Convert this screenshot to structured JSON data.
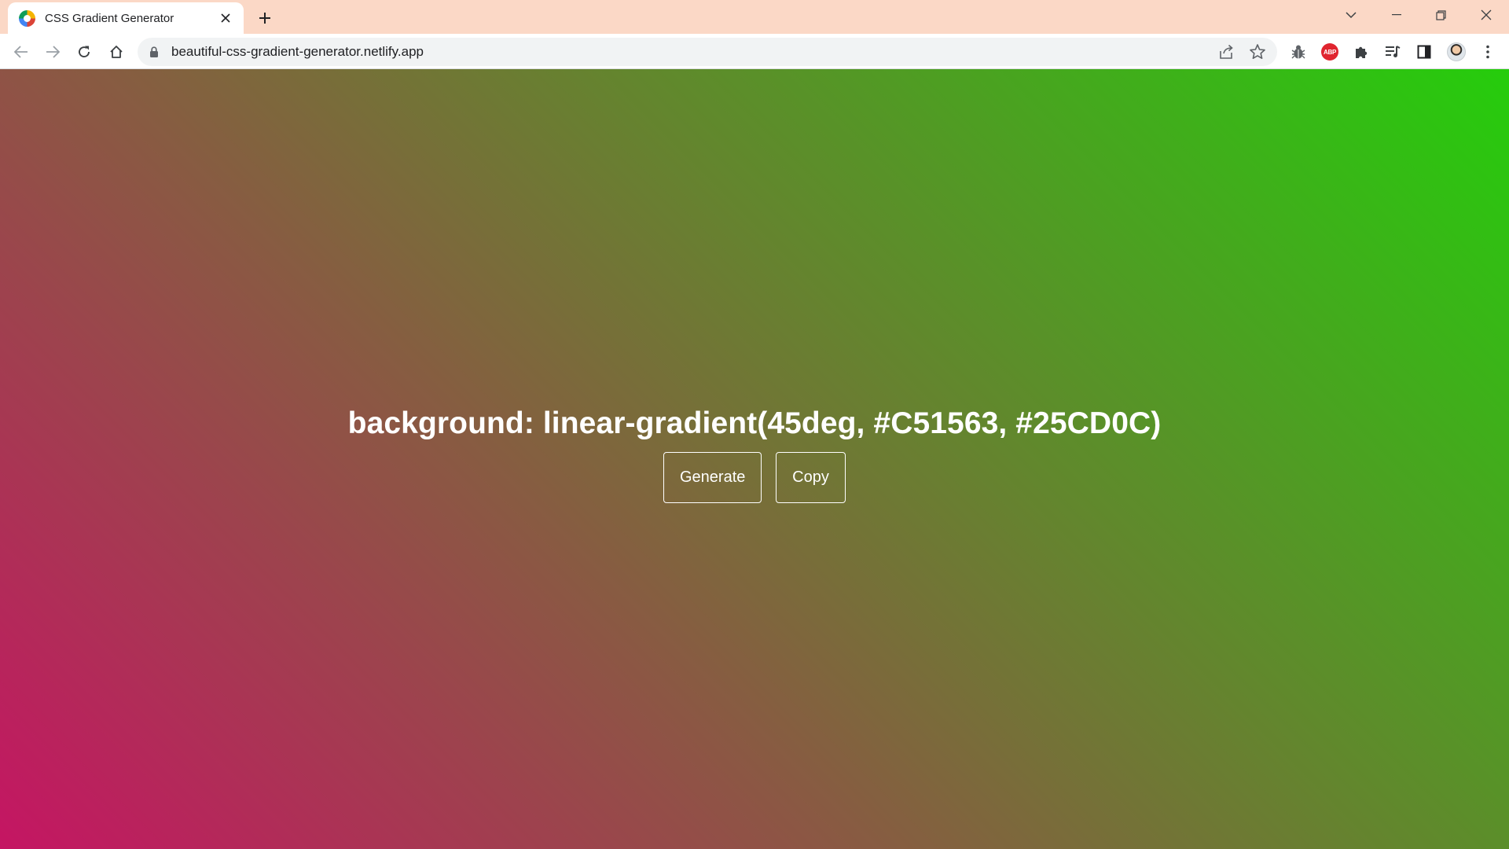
{
  "browser": {
    "tab": {
      "title": "CSS Gradient Generator",
      "favicon": "chrome-circle-icon"
    },
    "window_controls": [
      "tab-search-icon",
      "minimize-icon",
      "restore-icon",
      "close-icon"
    ],
    "address": {
      "url": "beautiful-css-gradient-generator.netlify.app"
    },
    "toolbar_icons": [
      "back-icon",
      "forward-icon",
      "reload-icon",
      "home-icon",
      "lock-icon",
      "share-icon",
      "star-icon",
      "bug-extension-icon",
      "adblock-plus-icon",
      "extensions-puzzle-icon",
      "reading-list-icon",
      "side-panel-icon",
      "profile-avatar",
      "more-menu-icon"
    ],
    "abp_label": "ABP"
  },
  "page": {
    "css_text": "background: linear-gradient(45deg, #C51563, #25CD0C)",
    "gradient": {
      "angle": "45deg",
      "color_start": "#C51563",
      "color_end": "#25CD0C"
    },
    "buttons": {
      "generate_label": "Generate",
      "copy_label": "Copy"
    }
  },
  "colors": {
    "tabstrip_bg": "#fbd8c6",
    "omnibox_bg": "#f1f3f4"
  }
}
